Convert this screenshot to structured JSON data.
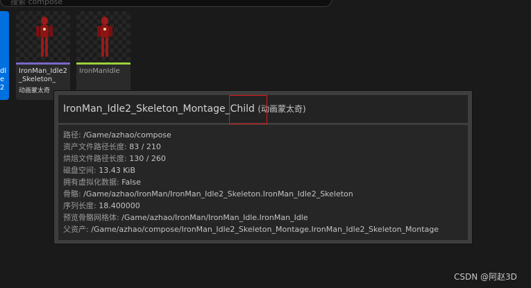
{
  "search": {
    "placeholder": "搜索 compose"
  },
  "assets": [
    {
      "label": "dle2",
      "sub": "",
      "bar_color": "#0070e0"
    },
    {
      "label": "IronMan_Idle2_Skeleton_",
      "sub": "动画蒙太奇",
      "bar_color": "#7b68c8"
    },
    {
      "label": "IronManIdle",
      "sub": "",
      "bar_color": "#9bd13b"
    }
  ],
  "tooltip": {
    "title": "IronMan_Idle2_Skeleton_Montage_Child",
    "type": "(动画蒙太奇)",
    "rows": [
      {
        "key": "路径:",
        "value": "/Game/azhao/compose"
      },
      {
        "key": "资产文件路径长度:",
        "value": "83 / 210"
      },
      {
        "key": "烘焙文件路径长度:",
        "value": "130 / 260"
      },
      {
        "key": "磁盘空间:",
        "value": "13.43 KiB"
      },
      {
        "key": "拥有虚拟化数据:",
        "value": "False"
      },
      {
        "key": "骨骼:",
        "value": "/Game/azhao/IronMan/IronMan_Idle2_Skeleton.IronMan_Idle2_Skeleton"
      },
      {
        "key": "序列长度:",
        "value": "18.400000"
      },
      {
        "key": "预览骨骼网格体:",
        "value": "/Game/azhao/IronMan/IronMan_Idle.IronMan_Idle"
      },
      {
        "key": "父资产:",
        "value": "/Game/azhao/compose/IronMan_Idle2_Skeleton_Montage.IronMan_Idle2_Skeleton_Montage"
      }
    ]
  },
  "colors": {
    "selected_tile": "#0070e0",
    "highlight": "#e0181b",
    "figure_red": "#8e1414"
  },
  "watermark": "CSDN @阿赵3D"
}
